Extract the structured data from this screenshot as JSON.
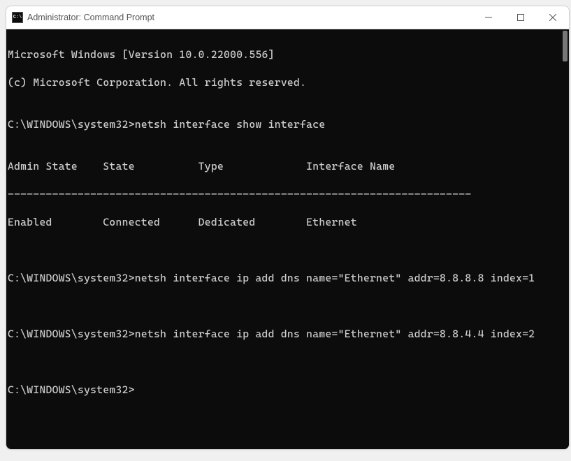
{
  "window": {
    "title": "Administrator: Command Prompt",
    "app_icon_label": "C:\\"
  },
  "terminal": {
    "banner_line1": "Microsoft Windows [Version 10.0.22000.556]",
    "banner_line2": "(c) Microsoft Corporation. All rights reserved.",
    "blank": "",
    "prompt_path": "C:\\WINDOWS\\system32>",
    "cmd1": "netsh interface show interface",
    "iface_header": "Admin State    State          Type             Interface Name",
    "iface_divider": "-------------------------------------------------------------------------",
    "iface_row1": "Enabled        Connected      Dedicated        Ethernet",
    "cmd2": "netsh interface ip add dns name=\"Ethernet\" addr=8.8.8.8 index=1",
    "cmd3": "netsh interface ip add dns name=\"Ethernet\" addr=8.8.4.4 index=2"
  }
}
